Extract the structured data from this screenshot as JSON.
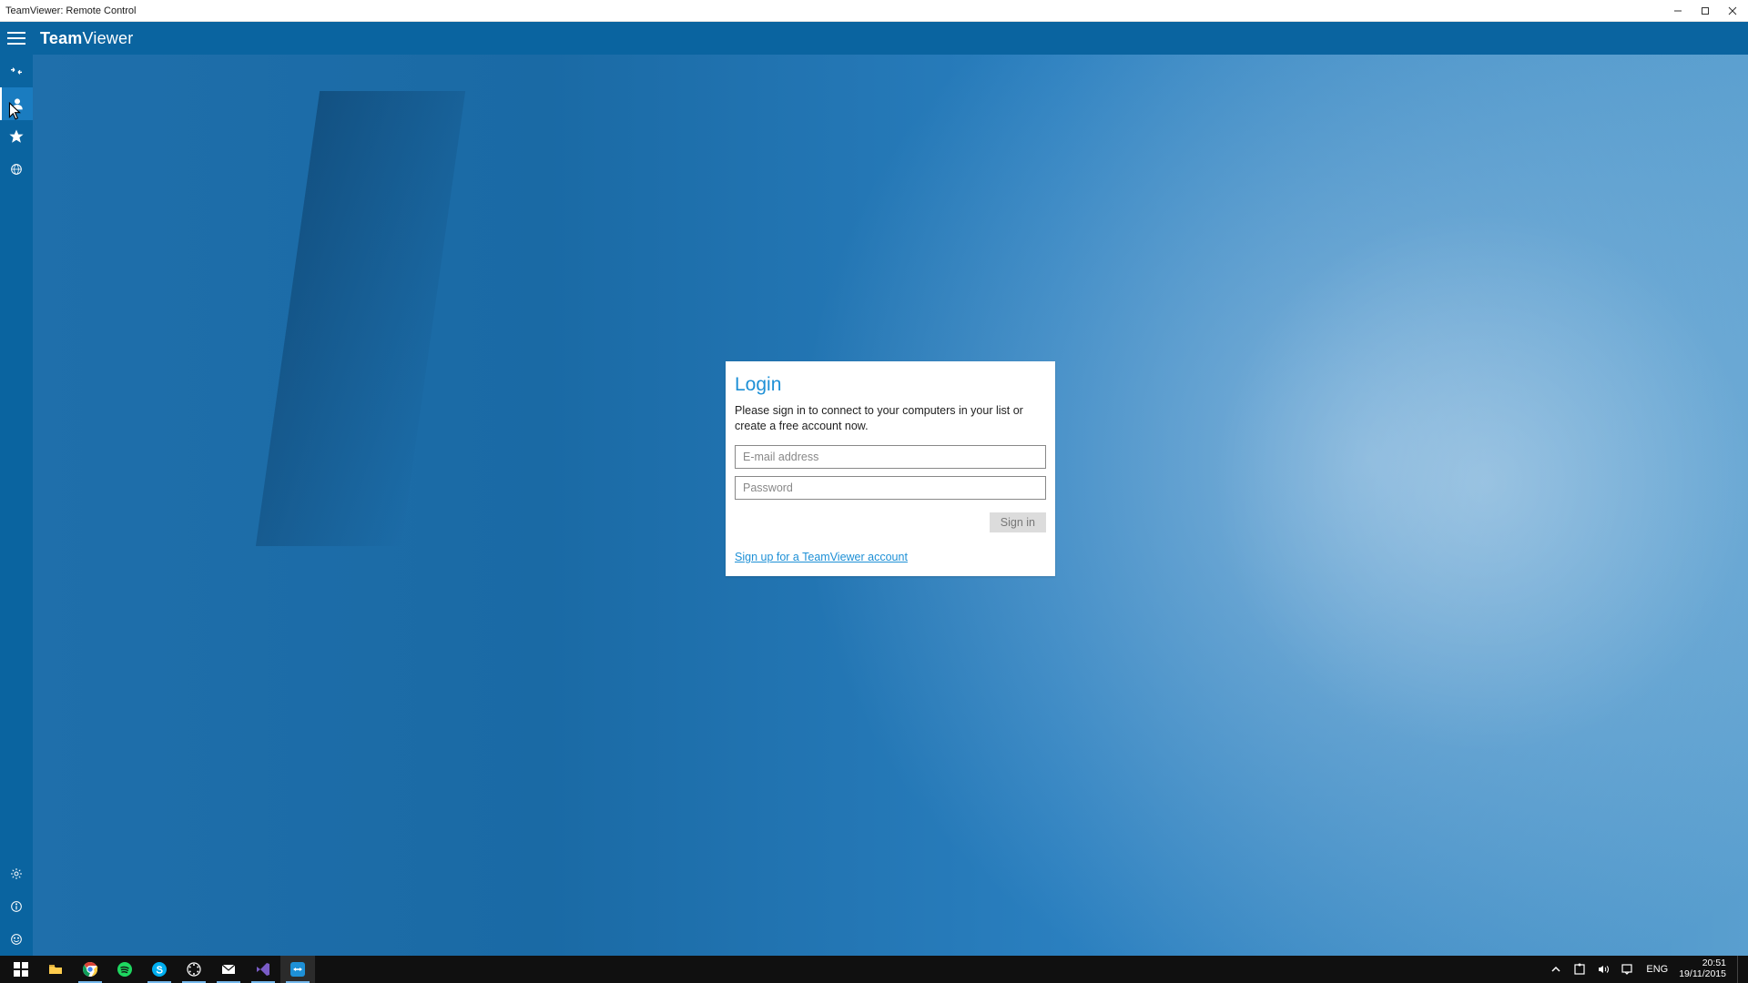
{
  "window": {
    "title": "TeamViewer: Remote Control"
  },
  "header": {
    "brand_bold": "Team",
    "brand_light": "Viewer"
  },
  "sidebar": {
    "top_items": [
      {
        "name": "remote-control",
        "icon": "arrows-horizontal",
        "active": false
      },
      {
        "name": "computers-contacts",
        "icon": "person",
        "active": true
      },
      {
        "name": "favorites",
        "icon": "star",
        "active": false
      },
      {
        "name": "meeting",
        "icon": "globe-person",
        "active": false
      }
    ],
    "bottom_items": [
      {
        "name": "settings",
        "icon": "gear",
        "active": false
      },
      {
        "name": "info",
        "icon": "info",
        "active": false
      },
      {
        "name": "feedback",
        "icon": "smile",
        "active": false
      }
    ]
  },
  "login": {
    "title": "Login",
    "description": "Please sign in to connect to your computers in your list or create a free account now.",
    "email_placeholder": "E-mail address",
    "password_placeholder": "Password",
    "signin_label": "Sign in",
    "signup_label": "Sign up for a TeamViewer account"
  },
  "taskbar": {
    "apps": [
      {
        "name": "start",
        "icon": "windows",
        "running": false,
        "active": false,
        "color": "#ffffff"
      },
      {
        "name": "file-explorer",
        "icon": "folder",
        "running": false,
        "active": false,
        "color": "#ffcc4d"
      },
      {
        "name": "chrome",
        "icon": "chrome",
        "running": true,
        "active": false
      },
      {
        "name": "spotify",
        "icon": "spotify",
        "running": false,
        "active": false,
        "color": "#1ed760"
      },
      {
        "name": "skype",
        "icon": "skype",
        "running": true,
        "active": false,
        "color": "#00aff0"
      },
      {
        "name": "app-circle",
        "icon": "circle-dots",
        "running": true,
        "active": false,
        "color": "#ffffff"
      },
      {
        "name": "mail",
        "icon": "mail",
        "running": true,
        "active": false,
        "color": "#ffffff"
      },
      {
        "name": "visual-studio",
        "icon": "vs",
        "running": true,
        "active": false,
        "color": "#7a5cc7"
      },
      {
        "name": "teamviewer",
        "icon": "tv",
        "running": true,
        "active": true,
        "color": "#1e90d6"
      }
    ],
    "tray": {
      "chevron": true,
      "icons": [
        "puzzle",
        "volume",
        "action-center"
      ],
      "lang": "ENG",
      "time": "20:51",
      "date": "19/11/2015"
    }
  }
}
